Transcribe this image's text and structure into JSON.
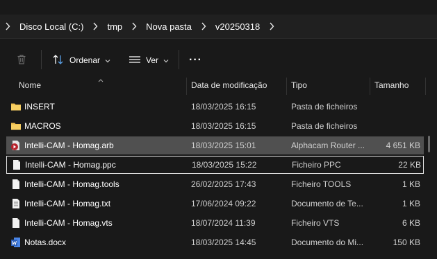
{
  "breadcrumb": [
    "Disco Local (C:)",
    "tmp",
    "Nova pasta",
    "v20250318"
  ],
  "toolbar": {
    "sort_label": "Ordenar",
    "view_label": "Ver",
    "more_label": "···"
  },
  "columns": {
    "name": "Nome",
    "date": "Data de modificação",
    "type": "Tipo",
    "size": "Tamanho"
  },
  "files": [
    {
      "icon": "folder-icon",
      "name": "INSERT",
      "date": "18/03/2025 16:15",
      "type": "Pasta de ficheiros",
      "size": ""
    },
    {
      "icon": "folder-icon",
      "name": "MACROS",
      "date": "18/03/2025 16:15",
      "type": "Pasta de ficheiros",
      "size": ""
    },
    {
      "icon": "alphacam-file-icon",
      "name": "Intelli-CAM - Homag.arb",
      "date": "18/03/2025 15:01",
      "type": "Alphacam Router ...",
      "size": "4 651 KB",
      "selected": true
    },
    {
      "icon": "file-icon",
      "name": "Intelli-CAM - Homag.ppc",
      "date": "18/03/2025 15:22",
      "type": "Ficheiro PPC",
      "size": "22 KB",
      "focused": true
    },
    {
      "icon": "file-icon",
      "name": "Intelli-CAM - Homag.tools",
      "date": "26/02/2025 17:43",
      "type": "Ficheiro TOOLS",
      "size": "1 KB"
    },
    {
      "icon": "text-file-icon",
      "name": "Intelli-CAM - Homag.txt",
      "date": "17/06/2024 09:22",
      "type": "Documento de Te...",
      "size": "1 KB"
    },
    {
      "icon": "file-icon",
      "name": "Intelli-CAM - Homag.vts",
      "date": "18/07/2024 11:39",
      "type": "Ficheiro VTS",
      "size": "6 KB"
    },
    {
      "icon": "word-doc-icon",
      "name": "Notas.docx",
      "date": "18/03/2025 14:45",
      "type": "Documento do Mi...",
      "size": "150 KB"
    }
  ],
  "colors": {
    "background": "#191919",
    "selected_row": "#505050",
    "folder": "#f2c14e",
    "word": "#2b5eb8",
    "alphacam": "#b8222b"
  }
}
